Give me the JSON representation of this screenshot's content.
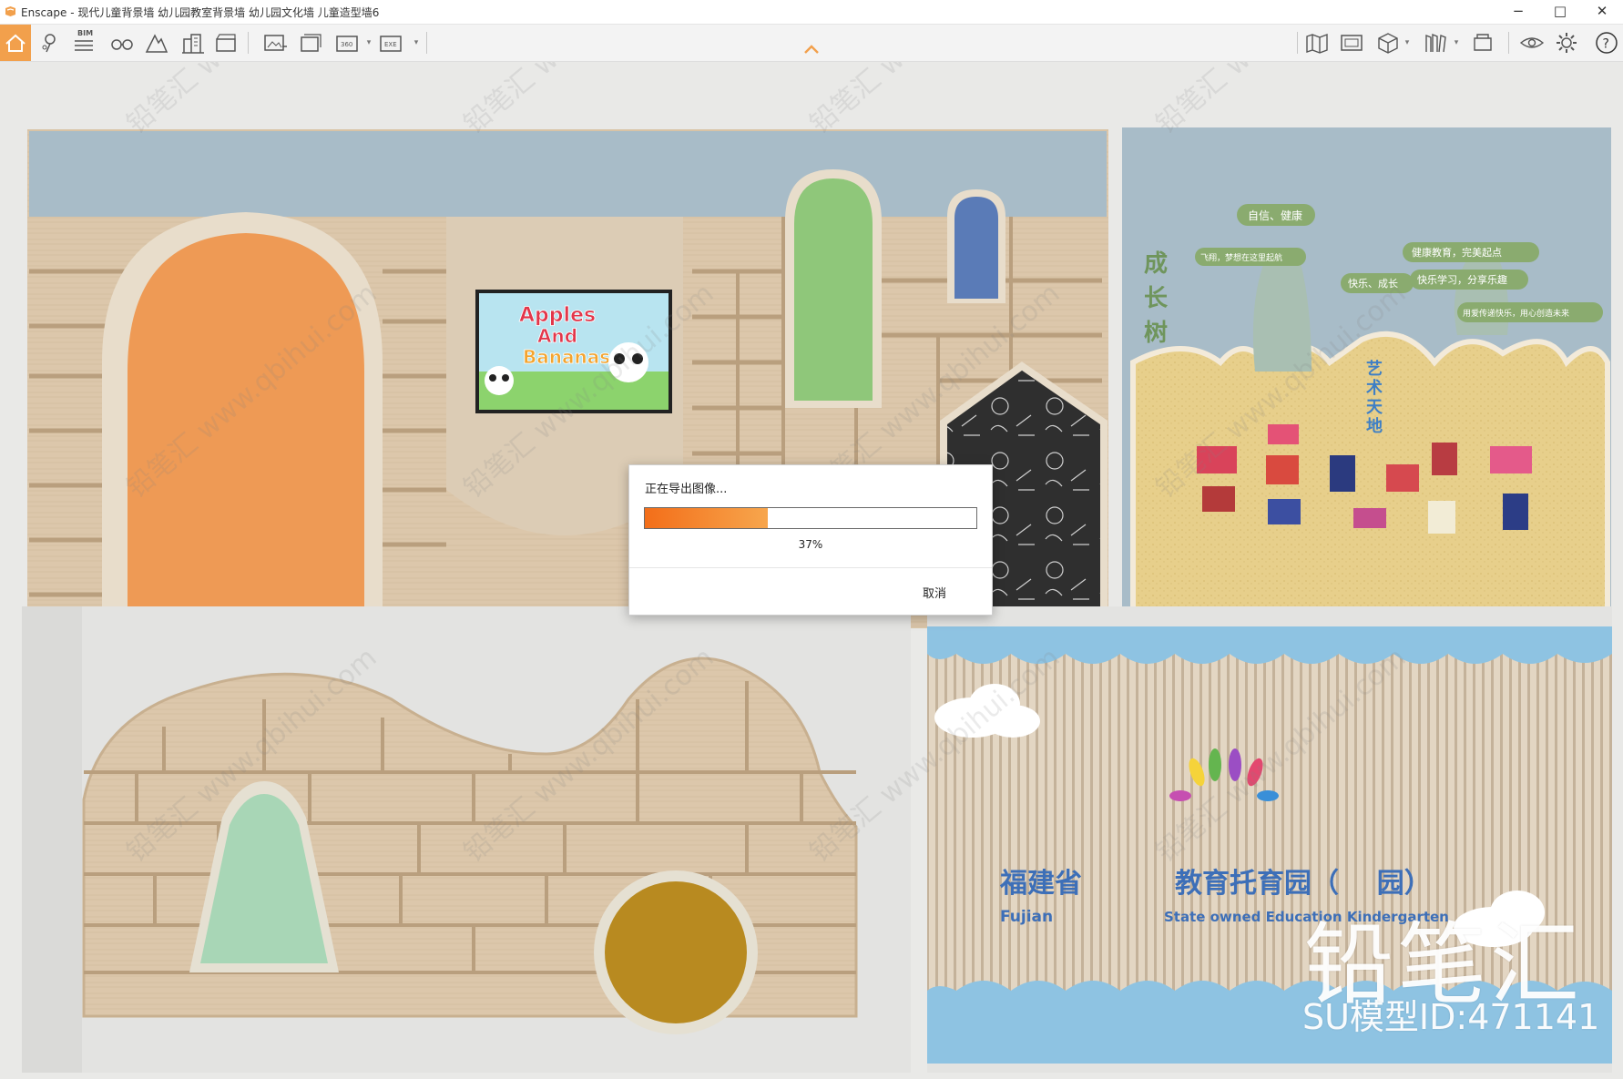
{
  "window": {
    "title": "Enscape - 现代儿童背景墙 幼儿园教室背景墙 幼儿园文化墙 儿童造型墙6",
    "minimize_glyph": "−",
    "maximize_glyph": "□",
    "close_glyph": "✕"
  },
  "toolbar": {
    "bim_label": "BIM",
    "left_icons": [
      "home-icon",
      "location-pin-icon",
      "bim-icon",
      "binoculars-icon",
      "mountain-icon",
      "building-icon",
      "video-icon",
      "export-image-icon",
      "batch-render-icon",
      "panorama-360-icon",
      "exe-export-icon"
    ],
    "right_icons": [
      "map-icon",
      "screen-capture-icon",
      "cube-icon",
      "library-icon",
      "package-icon",
      "eye-settings-icon",
      "gear-icon",
      "help-icon"
    ],
    "accent_color": "#f2a04c"
  },
  "viewport": {
    "top_left_scene": {
      "tv_text": [
        "Apples",
        "And",
        "Bananas"
      ]
    },
    "top_right_scene": {
      "vertical_title": [
        "成",
        "长",
        "树"
      ],
      "tree_labels": [
        "自信、健康",
        "快乐、成长",
        "健康教育，完美起点",
        "快乐学习，分享乐趣",
        "用爱传递快乐，用心创造未来",
        "飞翔，梦想在这里起航"
      ],
      "art_title": [
        "艺",
        "术",
        "天",
        "地"
      ]
    },
    "bottom_right_scene": {
      "province_cn": "福建省",
      "province_en": "Fujian",
      "school_cn": "教育托育园（    园）",
      "school_en": "State owned Education Kindergarten"
    },
    "watermark": {
      "brand": "铅笔汇",
      "model_id": "SU模型ID:471141",
      "tile_text": "铅笔汇 www.qbihui.com"
    }
  },
  "dialog": {
    "title": "正在导出图像...",
    "progress_percent": 37,
    "progress_label": "37%",
    "cancel_label": "取消",
    "progress_color": "#f36e19"
  }
}
